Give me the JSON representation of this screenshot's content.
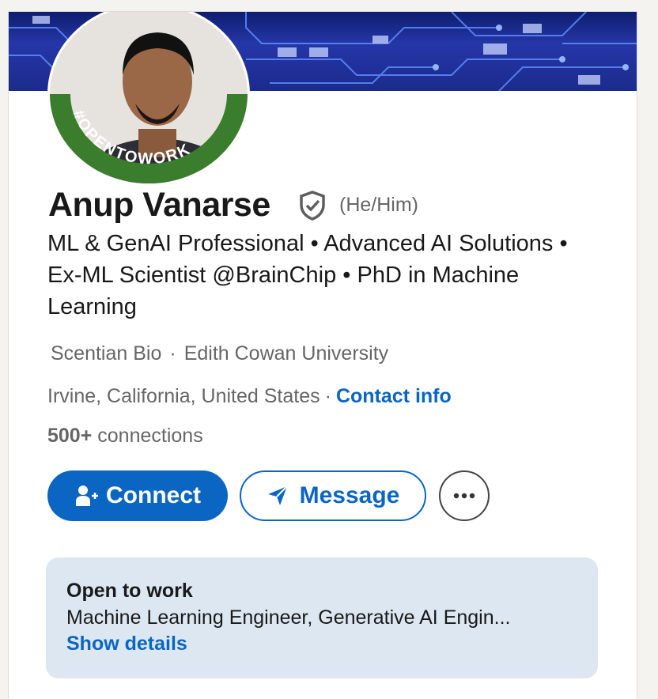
{
  "profile": {
    "name": "Anup Vanarse",
    "pronouns": "(He/Him)",
    "headline": "ML & GenAI Professional • Advanced AI Solutions • Ex-ML Scientist @BrainChip • PhD in Machine Learning",
    "company": "Scentian Bio",
    "education": "Edith Cowan University",
    "separator": "·",
    "location": "Irvine, California, United States",
    "contact_label": "Contact info",
    "connections_count": "500+",
    "connections_label": "connections",
    "avatar_frame_text": "#OPENTOWORK"
  },
  "actions": {
    "connect_label": "Connect",
    "message_label": "Message"
  },
  "open_to_work": {
    "title": "Open to work",
    "roles": "Machine Learning Engineer, Generative AI Engin...",
    "show_details": "Show details"
  },
  "colors": {
    "brand_blue": "#0a66c2",
    "open_to_work_green": "#3a7d2c",
    "card_bg": "#dde7f1"
  },
  "icons": {
    "verified": "shield-check-icon",
    "connect": "add-person-icon",
    "message": "send-icon",
    "more": "more-horizontal-icon"
  }
}
